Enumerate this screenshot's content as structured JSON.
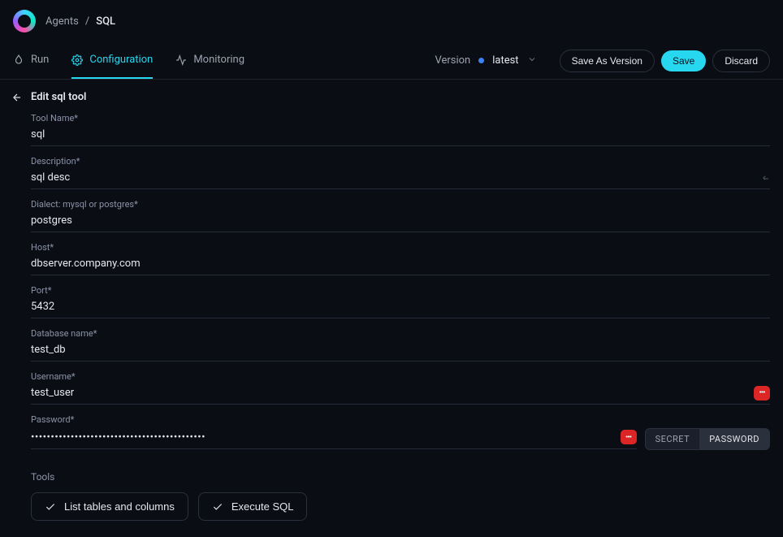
{
  "breadcrumb": {
    "parent": "Agents",
    "separator": "/",
    "current": "SQL"
  },
  "tabs": {
    "run": "Run",
    "configuration": "Configuration",
    "monitoring": "Monitoring"
  },
  "version": {
    "label": "Version",
    "value": "latest"
  },
  "actions": {
    "save_as_version": "Save As Version",
    "save": "Save",
    "discard": "Discard"
  },
  "page": {
    "title": "Edit sql tool"
  },
  "fields": {
    "tool_name": {
      "label": "Tool Name*",
      "value": "sql"
    },
    "description": {
      "label": "Description*",
      "value": "sql desc"
    },
    "dialect": {
      "label": "Dialect: mysql or postgres*",
      "value": "postgres"
    },
    "host": {
      "label": "Host*",
      "value": "dbserver.company.com"
    },
    "port": {
      "label": "Port*",
      "value": "5432"
    },
    "database": {
      "label": "Database name*",
      "value": "test_db"
    },
    "username": {
      "label": "Username*",
      "value": "test_user"
    },
    "password": {
      "label": "Password*",
      "value": "••••••••••••••••••••••••••••••••••••••••••••"
    }
  },
  "password_toggle": {
    "secret": "SECRET",
    "password": "PASSWORD"
  },
  "tools_section": {
    "label": "Tools",
    "list_tables": "List tables and columns",
    "execute_sql": "Execute SQL"
  }
}
